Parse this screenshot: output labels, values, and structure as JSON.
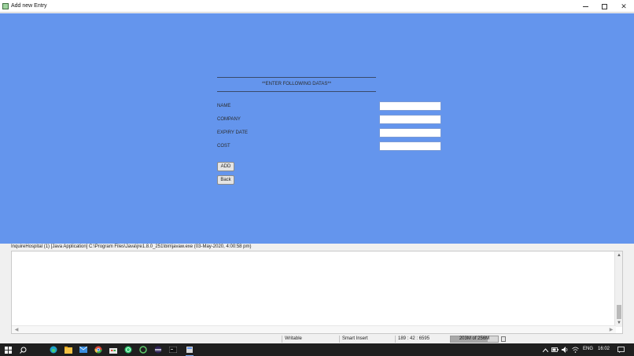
{
  "window": {
    "title": "Add new Entry"
  },
  "form": {
    "heading": "**ENTER FOLLOWING DATAS**",
    "fields": [
      {
        "label": "NAME",
        "value": ""
      },
      {
        "label": "COMPANY",
        "value": ""
      },
      {
        "label": "EXPIRY DATE",
        "value": ""
      },
      {
        "label": "COST",
        "value": ""
      }
    ],
    "add_label": "ADD",
    "back_label": "Back"
  },
  "console": {
    "header": "InquireHospital (1) [Java Application] C:\\Program Files\\Java\\jre1.8.0_251\\bin\\javaw.exe (03-May-2020, 4:00:58 pm)"
  },
  "statusbar": {
    "writable": "Writable",
    "insert_mode": "Smart Insert",
    "position": "189 : 42 : 6595",
    "heap": "203M of 256M",
    "heap_fraction": 0.79
  },
  "taskbar": {
    "language": "ENG",
    "time": "16:02",
    "icons": [
      "windows-start-icon",
      "search-icon",
      "edge-icon",
      "file-explorer-icon",
      "mail-icon",
      "chrome-icon",
      "store-icon",
      "whatsapp-icon",
      "circle-app-icon",
      "eclipse-icon",
      "terminal-icon",
      "java-app-icon"
    ]
  },
  "colors": {
    "panel": "#6495ed",
    "taskbar": "#1f1f1f"
  }
}
